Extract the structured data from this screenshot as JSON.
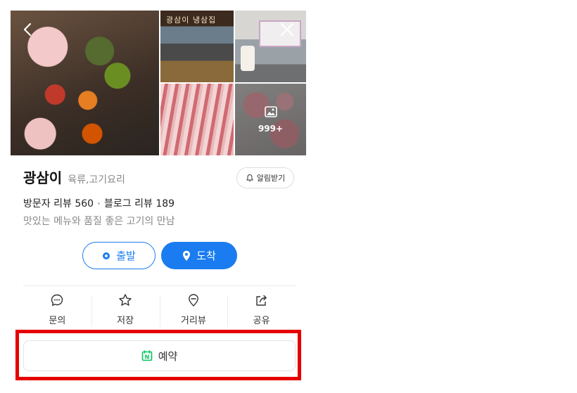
{
  "place": {
    "name": "광삼이",
    "category": "육류,고기요리",
    "alarm_label": "알림받기",
    "visitor_review_label": "방문자 리뷰",
    "visitor_review_count": "560",
    "blog_review_label": "블로그 리뷰",
    "blog_review_count": "189",
    "description": "맛있는 메뉴와 품질 좋은 고기의 만남"
  },
  "photos": {
    "more_count": "999+",
    "sign_text": "광삼이 냉삼집"
  },
  "directions": {
    "start_label": "출발",
    "arrive_label": "도착"
  },
  "actions": {
    "inquiry": "문의",
    "save": "저장",
    "street_view": "거리뷰",
    "share": "공유"
  },
  "reserve": {
    "label": "예약",
    "badge": "N"
  },
  "colors": {
    "accent": "#1a7cf0",
    "highlight": "#e60000",
    "naver_green": "#03c75a"
  }
}
